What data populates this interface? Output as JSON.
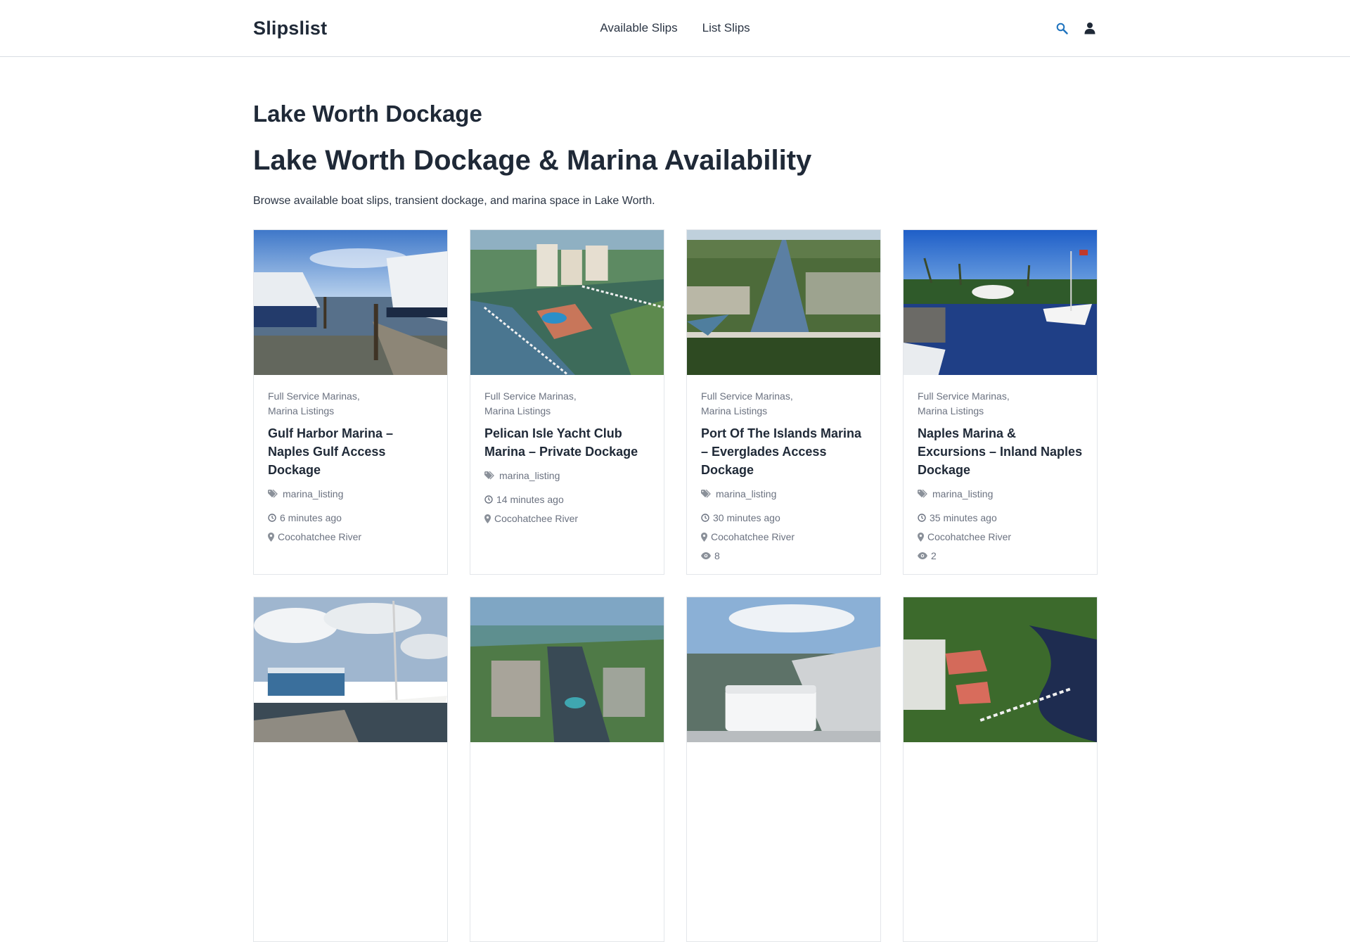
{
  "brand": "Slipslist",
  "nav": {
    "available": "Available Slips",
    "list": "List Slips"
  },
  "icons": {
    "search": "search-icon",
    "account": "user-icon"
  },
  "colors": {
    "accent": "#1e73be",
    "text": "#1f2937",
    "muted": "#6b7280"
  },
  "page": {
    "title": "Lake Worth Dockage",
    "heading": "Lake Worth Dockage & Marina Availability",
    "description": "Browse available boat slips, transient dockage, and marina space in Lake Worth."
  },
  "cards": [
    {
      "cat1": "Full Service Marinas",
      "cat2": "Marina Listings",
      "title": "Gulf Harbor Marina – Naples Gulf Access Dockage",
      "tag": "marina_listing",
      "time": "6 minutes ago",
      "location": "Cocohatchee River",
      "views": ""
    },
    {
      "cat1": "Full Service Marinas",
      "cat2": "Marina Listings",
      "title": "Pelican Isle Yacht Club Marina – Private Dockage",
      "tag": "marina_listing",
      "time": "14 minutes ago",
      "location": "Cocohatchee River",
      "views": ""
    },
    {
      "cat1": "Full Service Marinas",
      "cat2": "Marina Listings",
      "title": "Port Of The Islands Marina – Everglades Access Dockage",
      "tag": "marina_listing",
      "time": "30 minutes ago",
      "location": "Cocohatchee River",
      "views": "8"
    },
    {
      "cat1": "Full Service Marinas",
      "cat2": "Marina Listings",
      "title": "Naples Marina & Excursions – Inland Naples Dockage",
      "tag": "marina_listing",
      "time": "35 minutes ago",
      "location": "Cocohatchee River",
      "views": "2"
    }
  ]
}
